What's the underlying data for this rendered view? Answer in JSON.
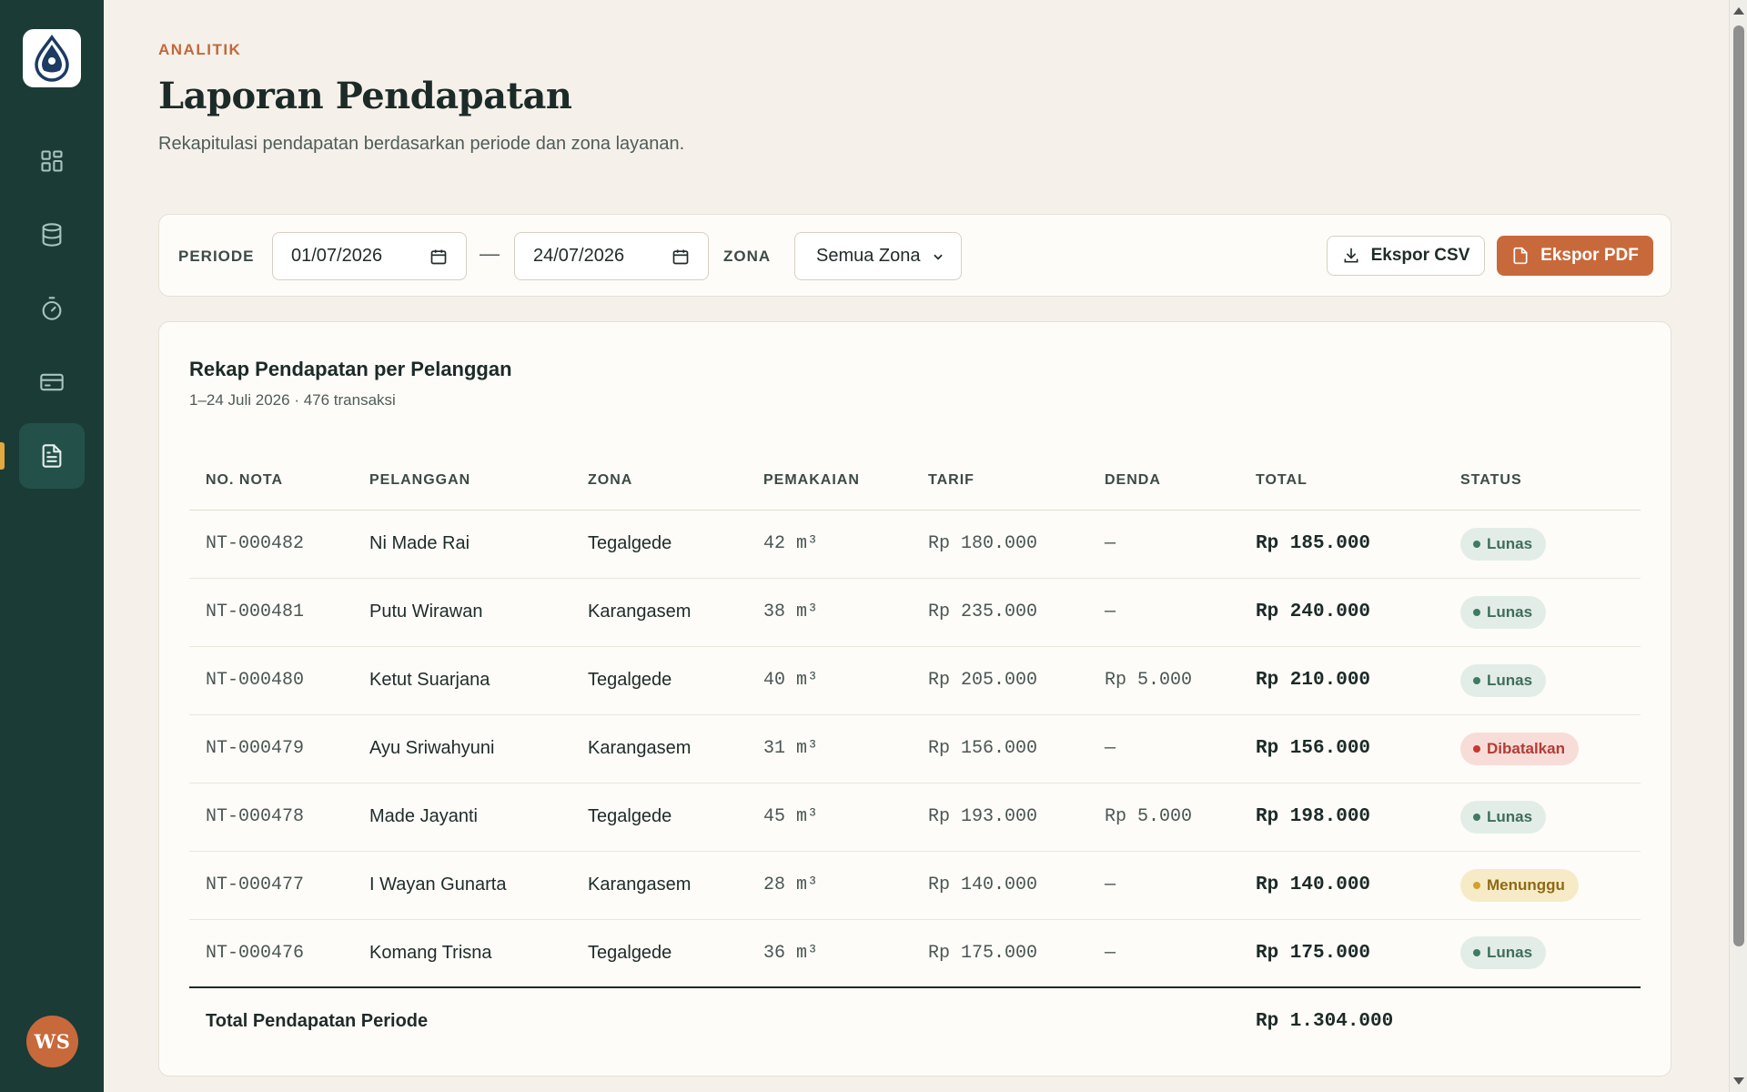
{
  "header": {
    "eyebrow": "ANALITIK",
    "title": "Laporan Pendapatan",
    "subtitle": "Rekapitulasi pendapatan berdasarkan periode dan zona layanan."
  },
  "sidebar": {
    "items": [
      {
        "icon": "dashboard-grid-icon",
        "active": false
      },
      {
        "icon": "database-icon",
        "active": false
      },
      {
        "icon": "stopwatch-icon",
        "active": false
      },
      {
        "icon": "credit-card-icon",
        "active": false
      },
      {
        "icon": "document-icon",
        "active": true
      }
    ],
    "avatar_initials": "WS"
  },
  "filters": {
    "period_label": "PERIODE",
    "date_from": "01/07/2026",
    "date_to": "24/07/2026",
    "separator": "—",
    "zone_label": "ZONA",
    "zone_value": "Semua Zona",
    "export_csv": "Ekspor CSV",
    "export_pdf": "Ekspor PDF"
  },
  "report": {
    "title": "Rekap Pendapatan per Pelanggan",
    "subtitle": "1–24 Juli 2026 · 476 transaksi",
    "columns": [
      "NO. NOTA",
      "PELANGGAN",
      "ZONA",
      "PEMAKAIAN",
      "TARIF",
      "DENDA",
      "TOTAL",
      "STATUS"
    ],
    "rows": [
      {
        "nota": "NT-000482",
        "pelanggan": "Ni Made Rai",
        "zona": "Tegalgede",
        "pemakaian": "42 m³",
        "tarif": "Rp 180.000",
        "denda": "—",
        "total": "Rp 185.000",
        "status": "Lunas",
        "status_type": "paid"
      },
      {
        "nota": "NT-000481",
        "pelanggan": "Putu Wirawan",
        "zona": "Karangasem",
        "pemakaian": "38 m³",
        "tarif": "Rp 235.000",
        "denda": "—",
        "total": "Rp 240.000",
        "status": "Lunas",
        "status_type": "paid"
      },
      {
        "nota": "NT-000480",
        "pelanggan": "Ketut Suarjana",
        "zona": "Tegalgede",
        "pemakaian": "40 m³",
        "tarif": "Rp 205.000",
        "denda": "Rp 5.000",
        "total": "Rp 210.000",
        "status": "Lunas",
        "status_type": "paid"
      },
      {
        "nota": "NT-000479",
        "pelanggan": "Ayu Sriwahyuni",
        "zona": "Karangasem",
        "pemakaian": "31 m³",
        "tarif": "Rp 156.000",
        "denda": "—",
        "total": "Rp 156.000",
        "status": "Dibatalkan",
        "status_type": "cancel"
      },
      {
        "nota": "NT-000478",
        "pelanggan": "Made Jayanti",
        "zona": "Tegalgede",
        "pemakaian": "45 m³",
        "tarif": "Rp 193.000",
        "denda": "Rp 5.000",
        "total": "Rp 198.000",
        "status": "Lunas",
        "status_type": "paid"
      },
      {
        "nota": "NT-000477",
        "pelanggan": "I Wayan Gunarta",
        "zona": "Karangasem",
        "pemakaian": "28 m³",
        "tarif": "Rp 140.000",
        "denda": "—",
        "total": "Rp 140.000",
        "status": "Menunggu",
        "status_type": "pending"
      },
      {
        "nota": "NT-000476",
        "pelanggan": "Komang Trisna",
        "zona": "Tegalgede",
        "pemakaian": "36 m³",
        "tarif": "Rp 175.000",
        "denda": "—",
        "total": "Rp 175.000",
        "status": "Lunas",
        "status_type": "paid"
      }
    ],
    "footer_label": "Total Pendapatan Periode",
    "footer_total": "Rp 1.304.000"
  },
  "colors": {
    "sidebar_bg": "#1b3b37",
    "accent": "#c8693b",
    "page_bg": "#f5f1ea",
    "paid": "#3f7a63",
    "cancel": "#c8382f",
    "pending": "#d3a12a"
  }
}
